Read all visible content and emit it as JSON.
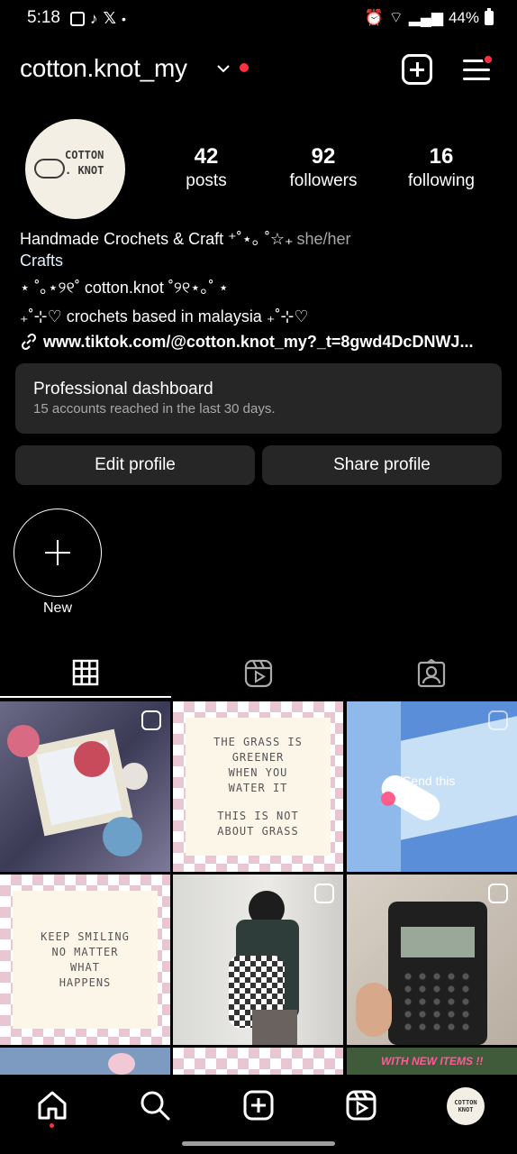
{
  "status_bar": {
    "time": "5:18",
    "battery": "44%"
  },
  "header": {
    "username": "cotton.knot_my"
  },
  "profile": {
    "avatar_text": [
      "COTTON",
      ". KNOT"
    ],
    "stats": [
      {
        "value": "42",
        "label": "posts"
      },
      {
        "value": "92",
        "label": "followers"
      },
      {
        "value": "16",
        "label": "following"
      }
    ],
    "bio": {
      "name": "Handmade Crochets & Craft ⁺˚⋆｡ ˚☆₊",
      "pronouns": "she/her",
      "category": "Crafts",
      "line1": "⋆ ˚｡⋆୨୧˚ cotton.knot ˚୨୧⋆｡˚ ⋆",
      "line2": "₊˚⊹♡ crochets based in malaysia ₊˚⊹♡",
      "link": "www.tiktok.com/@cotton.knot_my?_t=8gwd4DcDNWJ..."
    }
  },
  "dashboard": {
    "title": "Professional dashboard",
    "subtitle": "15 accounts reached in the last 30 days."
  },
  "buttons": {
    "edit": "Edit profile",
    "share": "Share profile"
  },
  "highlights": {
    "new_label": "New"
  },
  "grid": {
    "quote1": [
      "THE GRASS IS",
      "GREENER",
      "WHEN YOU",
      "WATER IT",
      "",
      "THIS IS NOT",
      "ABOUT GRASS"
    ],
    "quote2": [
      "KEEP SMILING",
      "NO MATTER",
      "WHAT",
      "HAPPENS"
    ],
    "send_this": "Send this",
    "new_items": "WITH NEW ITEMS !!"
  },
  "nav": {
    "avatar_text": "COTTON KNOT"
  }
}
